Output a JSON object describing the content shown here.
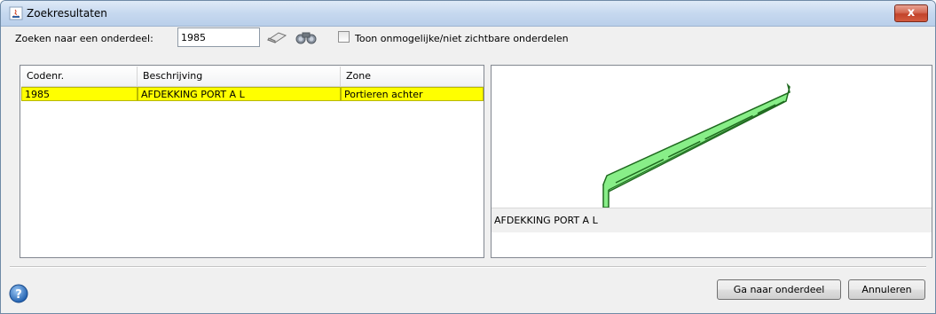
{
  "window": {
    "title": "Zoekresultaten",
    "close_label": "x"
  },
  "search": {
    "label": "Zoeken naar een onderdeel:",
    "value": "1985",
    "show_hidden_label": "Toon onmogelijke/niet zichtbare onderdelen",
    "show_hidden_checked": false
  },
  "table": {
    "columns": [
      "Codenr.",
      "Beschrijving",
      "Zone"
    ],
    "rows": [
      {
        "code": "1985",
        "description": "AFDEKKING PORT A L",
        "zone": "Portieren achter",
        "selected": true
      }
    ]
  },
  "preview": {
    "caption": "AFDEKKING PORT A L",
    "part_color": "#80e880"
  },
  "buttons": {
    "go_to_part": "Ga naar onderdeel",
    "cancel": "Annuleren"
  },
  "colors": {
    "selection_highlight": "#ffff00",
    "title_gradient": "#c6d8ef",
    "close_button": "#c2442b"
  }
}
